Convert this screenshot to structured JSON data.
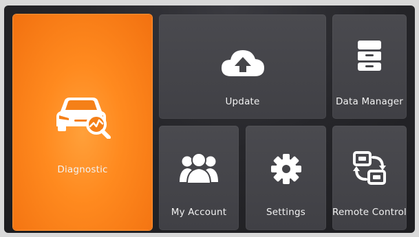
{
  "tiles": {
    "diagnostic": {
      "label": "Diagnostic",
      "icon": "car-diagnostic-icon"
    },
    "update": {
      "label": "Update",
      "icon": "cloud-upload-icon"
    },
    "data_manager": {
      "label": "Data Manager",
      "icon": "cabinet-icon"
    },
    "my_account": {
      "label": "My Account",
      "icon": "users-icon"
    },
    "settings": {
      "label": "Settings",
      "icon": "gear-icon"
    },
    "remote_control": {
      "label": "Remote Control",
      "icon": "remote-connection-icon"
    }
  },
  "colors": {
    "accent": "#ff8a1f",
    "tile": "#444449",
    "background": "#222226",
    "text": "#ffffff"
  }
}
